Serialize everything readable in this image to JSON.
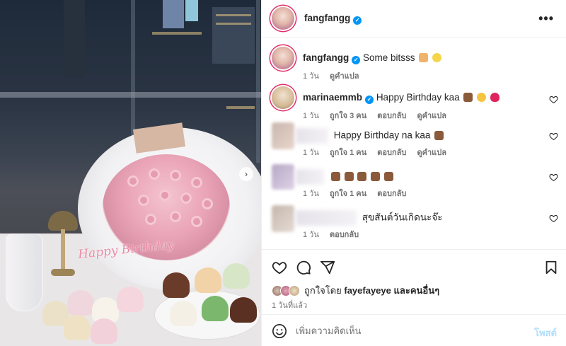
{
  "post": {
    "author": "fangfangg",
    "photo_sign_text": "Happy Birthday"
  },
  "header": {
    "username": "fangfangg",
    "more_label": "•••"
  },
  "caption": {
    "username": "fangfangg",
    "text": "Some bitsss",
    "time": "1 วัน",
    "translate": "ดูคำแปล"
  },
  "comments": [
    {
      "username": "marinaemmb",
      "verified": true,
      "text": "Happy Birthday kaa",
      "time": "1 วัน",
      "likes": "ถูกใจ 3 คน",
      "reply": "ตอบกลับ",
      "translate": "ดูคำแปล"
    },
    {
      "username": "",
      "text": "Happy Birthday na kaa",
      "time": "1 วัน",
      "likes": "ถูกใจ 1 คน",
      "reply": "ตอบกลับ",
      "translate": "ดูคำแปล"
    },
    {
      "username": "",
      "text": "",
      "time": "1 วัน",
      "likes": "ถูกใจ 1 คน",
      "reply": "ตอบกลับ"
    },
    {
      "username": "",
      "text": "สุขสันต์วันเกิดนะจ๊ะ",
      "time": "1 วัน",
      "reply": "ตอบกลับ"
    }
  ],
  "actions": {
    "liked_by_prefix": "ถูกใจโดย",
    "liked_by_user": "fayefayeye",
    "liked_by_suffix": "และคนอื่นๆ",
    "date": "1 วันที่แล้ว"
  },
  "composer": {
    "placeholder": "เพิ่มความคิดเห็น",
    "post_label": "โพสต์"
  },
  "icons": {
    "verified": "verified-badge-icon",
    "heart": "heart-icon",
    "comment": "comment-icon",
    "share": "share-icon",
    "save": "bookmark-icon",
    "emoji": "emoji-smile-icon",
    "more": "more-horizontal-icon",
    "next": "chevron-right-icon"
  },
  "colors": {
    "verified": "#0095f6",
    "link": "#0095f6",
    "post_disabled": "#b2dffc",
    "secondary_text": "#737373",
    "heart_red": "#ed4956"
  }
}
